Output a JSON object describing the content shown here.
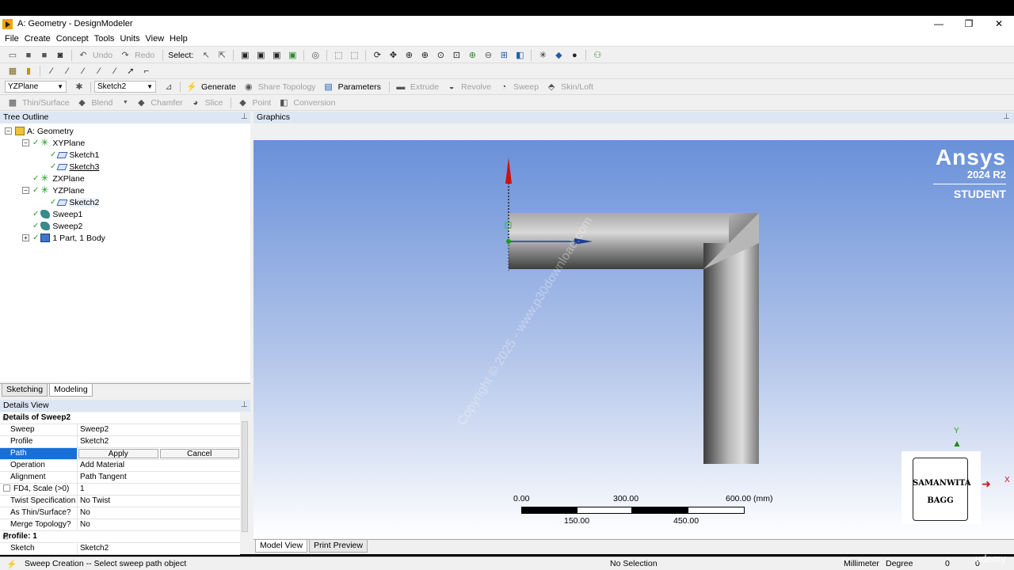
{
  "window": {
    "title": "A: Geometry - DesignModeler",
    "controls": [
      "—",
      "❐",
      "✕"
    ]
  },
  "menu": [
    "File",
    "Create",
    "Concept",
    "Tools",
    "Units",
    "View",
    "Help"
  ],
  "toolbar1": {
    "undo": "Undo",
    "redo": "Redo",
    "select": "Select:"
  },
  "toolbar3": {
    "plane": "YZPlane",
    "sketch": "Sketch2",
    "generate": "Generate",
    "share_topology": "Share Topology",
    "parameters": "Parameters",
    "extrude": "Extrude",
    "revolve": "Revolve",
    "sweep": "Sweep",
    "skin_loft": "Skin/Loft"
  },
  "toolbar4": {
    "thin_surface": "Thin/Surface",
    "blend": "Blend",
    "chamfer": "Chamfer",
    "slice": "Slice",
    "point": "Point",
    "conversion": "Conversion"
  },
  "tree": {
    "header": "Tree Outline",
    "nodes": [
      {
        "label": "A: Geometry",
        "depth": 0,
        "expander": "−",
        "icon": "geometry-icon"
      },
      {
        "label": "XYPlane",
        "depth": 1,
        "expander": "−",
        "icon": "plane-icon"
      },
      {
        "label": "Sketch1",
        "depth": 2,
        "expander": "",
        "icon": "sketch-icon"
      },
      {
        "label": "Sketch3",
        "depth": 2,
        "expander": "",
        "icon": "sketch-icon"
      },
      {
        "label": "ZXPlane",
        "depth": 1,
        "expander": "",
        "icon": "plane-icon"
      },
      {
        "label": "YZPlane",
        "depth": 1,
        "expander": "−",
        "icon": "plane-icon"
      },
      {
        "label": "Sketch2",
        "depth": 2,
        "expander": "",
        "icon": "sketch-icon"
      },
      {
        "label": "Sweep1",
        "depth": 1,
        "expander": "",
        "icon": "sweep-icon"
      },
      {
        "label": "Sweep2",
        "depth": 1,
        "expander": "",
        "icon": "sweep-icon"
      },
      {
        "label": "1 Part, 1 Body",
        "depth": 1,
        "expander": "+",
        "icon": "body-icon"
      }
    ],
    "tabs": [
      "Sketching",
      "Modeling"
    ]
  },
  "details": {
    "header": "Details View",
    "group1": "Details of Sweep2",
    "rows": [
      {
        "key": "Sweep",
        "value": "Sweep2"
      },
      {
        "key": "Profile",
        "value": "Sketch2"
      }
    ],
    "path": {
      "key": "Path",
      "apply": "Apply",
      "cancel": "Cancel"
    },
    "rows2": [
      {
        "key": "Operation",
        "value": "Add Material"
      },
      {
        "key": "Alignment",
        "value": "Path Tangent"
      },
      {
        "key": "FD4,  Scale (>0)",
        "value": "1"
      },
      {
        "key": "Twist Specification",
        "value": "No Twist"
      },
      {
        "key": "As Thin/Surface?",
        "value": "No"
      },
      {
        "key": "Merge Topology?",
        "value": "No"
      }
    ],
    "group2": "Profile: 1",
    "rows3": [
      {
        "key": "Sketch",
        "value": "Sketch2"
      }
    ]
  },
  "graphics": {
    "header": "Graphics",
    "brand": "Ansys",
    "version": "2024 R2",
    "edition": "STUDENT",
    "watermark": "Copyright © 2025 - www.p30download.com",
    "scale": {
      "top": [
        "0.00",
        "300.00",
        "600.00 (mm)"
      ],
      "bottom": [
        "150.00",
        "450.00"
      ]
    },
    "axis_y": "Y",
    "axis_x": "X",
    "signature": [
      "SAMANWITA",
      "BAGG"
    ],
    "tabs": [
      "Model View",
      "Print Preview"
    ]
  },
  "status": {
    "message": "Sweep Creation -- Select sweep path object",
    "selection": "No Selection",
    "units": "Millimeter",
    "angle": "Degree",
    "v1": "0",
    "v2": "0"
  },
  "watermark_brand": "udemy",
  "colors": {
    "selection": "#1a6fd6",
    "panel_header": "#dde7f3"
  }
}
